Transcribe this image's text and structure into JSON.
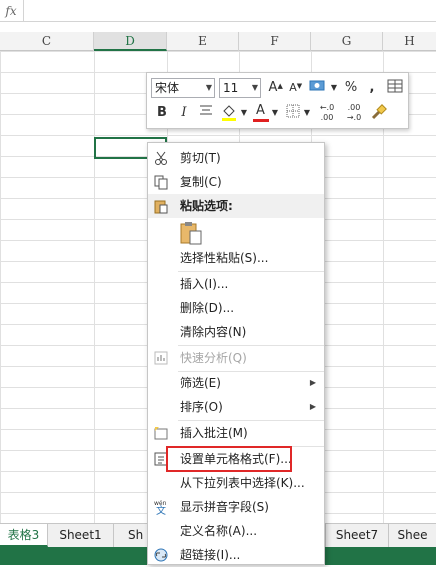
{
  "formula_bar": {
    "fx_label": "fx",
    "value": ""
  },
  "columns": [
    "C",
    "D",
    "E",
    "F",
    "G",
    "H"
  ],
  "selected_column": "D",
  "mini_toolbar": {
    "font_name": "宋体",
    "font_size": "11",
    "bold": "B",
    "italic": "I",
    "percent": "%",
    "comma": ",",
    "font_color_letter": "A",
    "grow_font": "A",
    "shrink_font": "A"
  },
  "context_menu": {
    "items": [
      {
        "label": "剪切(T)",
        "icon": "scissors-icon"
      },
      {
        "label": "复制(C)",
        "icon": "copy-icon"
      },
      {
        "label": "粘贴选项:",
        "icon": "paste-icon",
        "header": true
      },
      {
        "label": "选择性粘贴(S)..."
      },
      {
        "label": "插入(I)..."
      },
      {
        "label": "删除(D)..."
      },
      {
        "label": "清除内容(N)"
      },
      {
        "label": "快速分析(Q)",
        "icon": "quick-analysis-icon",
        "disabled": true
      },
      {
        "label": "筛选(E)",
        "submenu": true
      },
      {
        "label": "排序(O)",
        "submenu": true
      },
      {
        "label": "插入批注(M)",
        "icon": "comment-icon"
      },
      {
        "label": "设置单元格格式(F)...",
        "icon": "format-cells-icon"
      },
      {
        "label": "从下拉列表中选择(K)..."
      },
      {
        "label": "显示拼音字段(S)",
        "icon": "phonetic-icon"
      },
      {
        "label": "定义名称(A)..."
      },
      {
        "label": "超链接(I)...",
        "icon": "hyperlink-icon"
      }
    ]
  },
  "sheet_tabs": [
    "表格3",
    "Sheet1",
    "Sh",
    "Sheet7",
    "Shee"
  ],
  "active_tab": "表格3",
  "colors": {
    "accent": "#217346",
    "highlight": "#e02828"
  }
}
